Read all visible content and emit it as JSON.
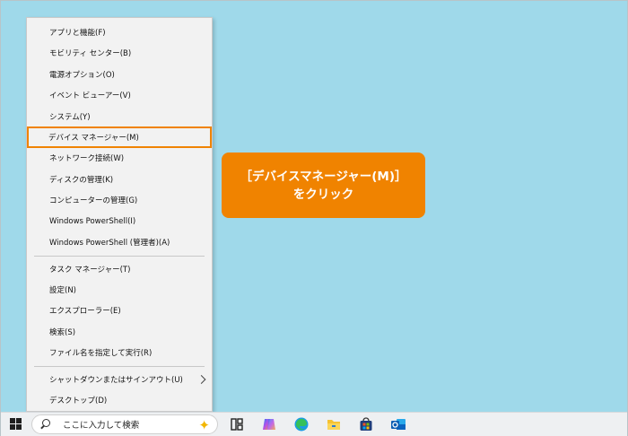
{
  "menu": {
    "items": [
      {
        "label": "アプリと機能(F)"
      },
      {
        "label": "モビリティ センター(B)"
      },
      {
        "label": "電源オプション(O)"
      },
      {
        "label": "イベント ビューアー(V)"
      },
      {
        "label": "システム(Y)"
      },
      {
        "label": "デバイス マネージャー(M)",
        "highlighted": true
      },
      {
        "label": "ネットワーク接続(W)"
      },
      {
        "label": "ディスクの管理(K)"
      },
      {
        "label": "コンピューターの管理(G)"
      },
      {
        "label": "Windows PowerShell(I)"
      },
      {
        "label": "Windows PowerShell (管理者)(A)"
      },
      {
        "label": "タスク マネージャー(T)"
      },
      {
        "label": "設定(N)"
      },
      {
        "label": "エクスプローラー(E)"
      },
      {
        "label": "検索(S)"
      },
      {
        "label": "ファイル名を指定して実行(R)"
      },
      {
        "label": "シャットダウンまたはサインアウト(U)",
        "submenu": true
      },
      {
        "label": "デスクトップ(D)"
      }
    ]
  },
  "callout": {
    "line1": "［デバイスマネージャー(M)］",
    "line2": "をクリック",
    "color": "#f08300"
  },
  "taskbar": {
    "search_placeholder": "ここに入力して検索",
    "icons": [
      "windows-start-icon",
      "search-icon",
      "copilot-sparkle-icon",
      "task-view-icon",
      "copilot-icon",
      "edge-icon",
      "file-explorer-icon",
      "microsoft-store-icon",
      "outlook-icon"
    ]
  },
  "colors": {
    "desktop": "#9fd9ea",
    "highlight": "#f08300"
  }
}
